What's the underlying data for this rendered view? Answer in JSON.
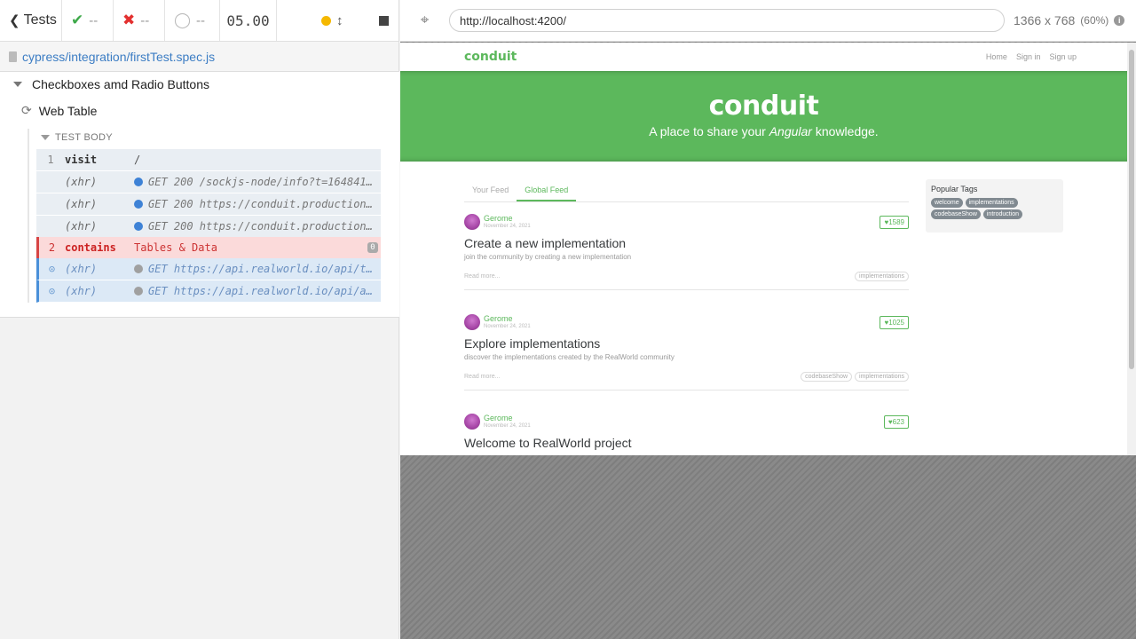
{
  "reporter": {
    "header": {
      "tests_label": "Tests",
      "passed": "--",
      "failed": "--",
      "pending": "--",
      "duration": "05.00"
    },
    "spec_file": "cypress/integration/firstTest.spec.js",
    "suite_title": "Checkboxes amd Radio Buttons",
    "test_title": "Web Table",
    "test_body_label": "TEST BODY",
    "commands": [
      {
        "num": "1",
        "name": "visit",
        "message": "/"
      },
      {
        "num": "",
        "name": "(xhr)",
        "message": "GET 200 /sockjs-node/info?t=1648412…"
      },
      {
        "num": "",
        "name": "(xhr)",
        "message": "GET 200 https://conduit.productionr…"
      },
      {
        "num": "",
        "name": "(xhr)",
        "message": "GET 200 https://conduit.productionr…"
      },
      {
        "num": "2",
        "name": "contains",
        "message": "Tables & Data",
        "badge": "0"
      },
      {
        "num": "",
        "name": "(xhr)",
        "message": "GET https://api.realworld.io/api/ta…"
      },
      {
        "num": "",
        "name": "(xhr)",
        "message": "GET https://api.realworld.io/api/ar…"
      }
    ]
  },
  "aut": {
    "url": "http://localhost:4200/",
    "viewport": "1366 x 768",
    "scale": "(60%)"
  },
  "site": {
    "brand": "conduit",
    "nav": [
      "Home",
      "Sign in",
      "Sign up"
    ],
    "banner_title": "conduit",
    "banner_tagline_prefix": "A place to share your ",
    "banner_tagline_em": "Angular",
    "banner_tagline_suffix": " knowledge.",
    "tabs": [
      "Your Feed",
      "Global Feed"
    ],
    "sidebar_title": "Popular Tags",
    "popular_tags": [
      "welcome",
      "implementations",
      "codebaseShow",
      "introduction"
    ],
    "articles": [
      {
        "author": "Gerome",
        "date": "November 24, 2021",
        "favorites": "1589",
        "title": "Create a new implementation",
        "description": "join the community by creating a new implementation",
        "read_more": "Read more...",
        "tags": [
          "implementations"
        ]
      },
      {
        "author": "Gerome",
        "date": "November 24, 2021",
        "favorites": "1025",
        "title": "Explore implementations",
        "description": "discover the implementations created by the RealWorld community",
        "read_more": "Read more...",
        "tags": [
          "codebaseShow",
          "implementations"
        ]
      },
      {
        "author": "Gerome",
        "date": "November 24, 2021",
        "favorites": "623",
        "title": "Welcome to RealWorld project",
        "description": "",
        "read_more": "",
        "tags": []
      }
    ]
  }
}
